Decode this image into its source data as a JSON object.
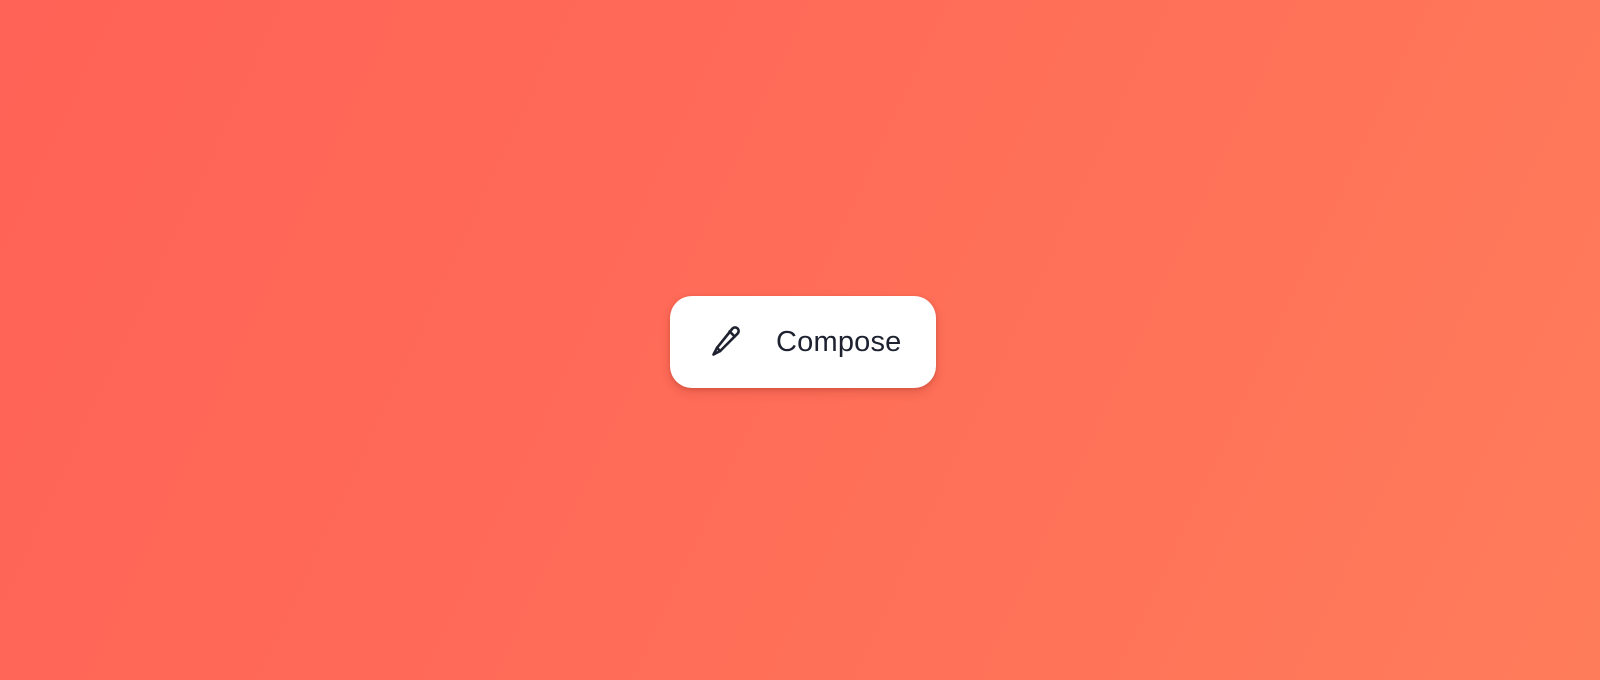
{
  "colors": {
    "background_start": "#ff6256",
    "background_end": "#ff7c5a",
    "button_background": "#ffffff",
    "button_text": "#1e2230"
  },
  "compose_button": {
    "icon": "pencil-icon",
    "label": "Compose"
  }
}
